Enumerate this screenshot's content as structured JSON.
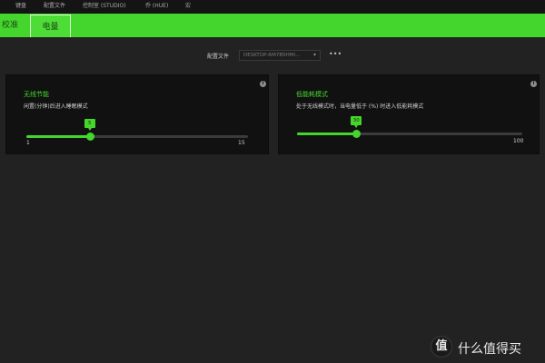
{
  "topnav": {
    "items": [
      "键盘",
      "配置文件",
      "控制室 (STUDIO)",
      "乔 (HUE)",
      "宏"
    ]
  },
  "subtabs": [
    {
      "label": "校准"
    },
    {
      "label": "电量"
    }
  ],
  "profile": {
    "label": "配置文件",
    "value": "DESKTOP-RM7B5HMI...",
    "caret": "▾",
    "more": "•••"
  },
  "cards": {
    "wireless": {
      "title": "无线节能",
      "desc": "闲置(分钟)后进入睡眠模式",
      "info": "i",
      "slider": {
        "value": 5,
        "min": 1,
        "max": 15,
        "bubble": "5",
        "min_label": "1",
        "max_label": "15"
      }
    },
    "lowpower": {
      "title": "低能耗模式",
      "desc": "处于无线模式时，当电量低于 (%) 时进入低能耗模式",
      "info": "i",
      "slider": {
        "value": 30,
        "min": 5,
        "max": 100,
        "bubble": "30",
        "min_label": "",
        "max_label": "100"
      }
    }
  },
  "watermark": {
    "logo": "值",
    "text": "什么值得买"
  },
  "colors": {
    "accent": "#44d62c",
    "background": "#222222",
    "card": "#111111"
  }
}
